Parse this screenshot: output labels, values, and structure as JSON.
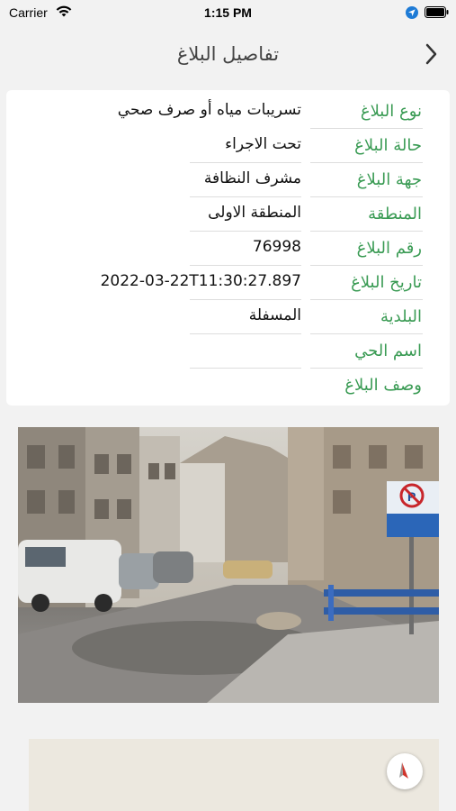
{
  "status_bar": {
    "carrier": "Carrier",
    "time": "1:15 PM"
  },
  "nav": {
    "title": "تفاصيل البلاغ",
    "back_icon": "chevron-icon"
  },
  "details": [
    {
      "label": "نوع البلاغ",
      "value": "تسريبات مياه أو صرف صحي"
    },
    {
      "label": "حالة البلاغ",
      "value": "تحت الاجراء"
    },
    {
      "label": "جهة البلاغ",
      "value": "مشرف النظافة"
    },
    {
      "label": "المنطقة",
      "value": "المنطقة الاولى"
    },
    {
      "label": "رقم البلاغ",
      "value": "76998"
    },
    {
      "label": "تاريخ البلاغ",
      "value": "2022-03-22T11:30:27.897"
    },
    {
      "label": "البلدية",
      "value": "المسفلة"
    },
    {
      "label": "اسم الحي",
      "value": ""
    },
    {
      "label": "وصف البلاغ",
      "value": ""
    }
  ],
  "colors": {
    "label_green": "#3a9b54",
    "background": "#f2f2f2"
  }
}
